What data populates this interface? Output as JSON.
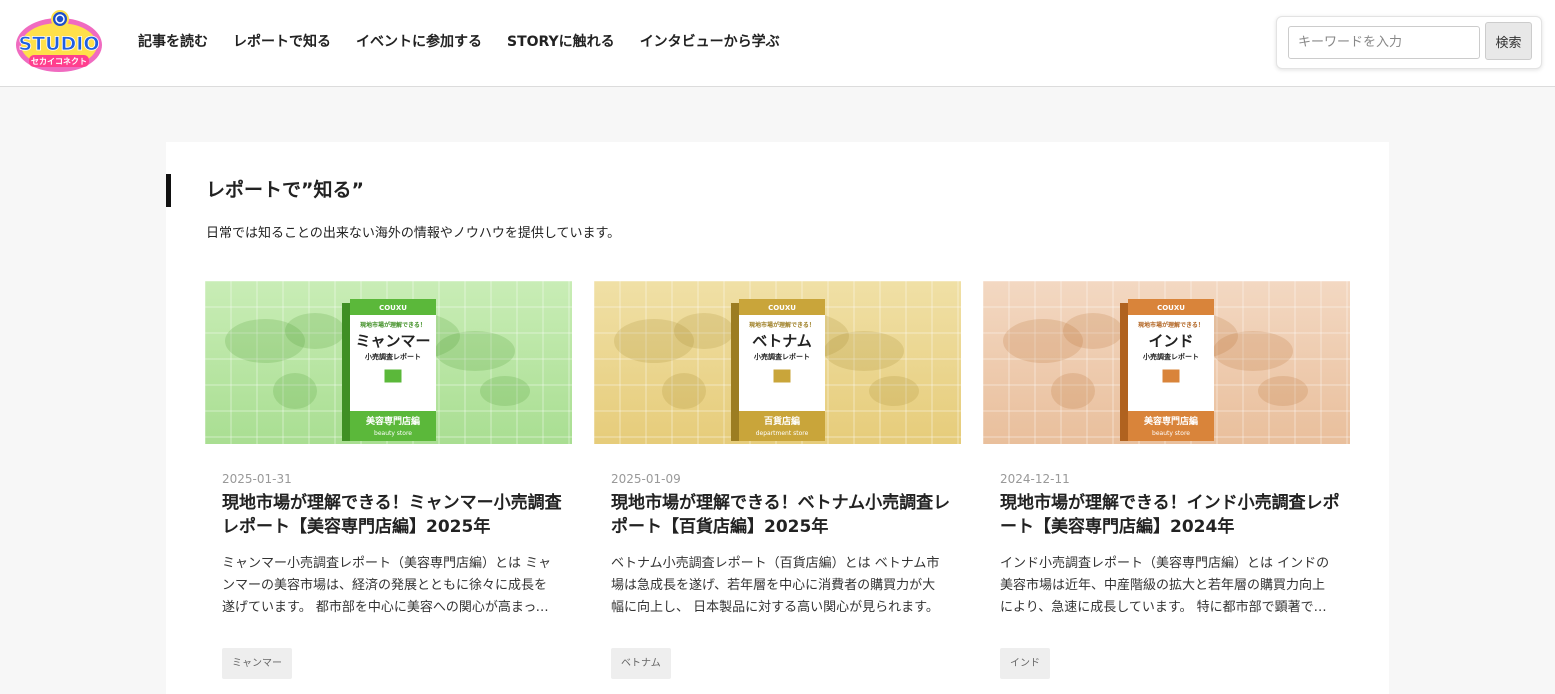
{
  "header": {
    "logo_text": "STUDIO",
    "logo_sub": "セカイコネクト",
    "nav": [
      "記事を読む",
      "レポートで知る",
      "イベントに参加する",
      "STORYに触れる",
      "インタビューから学ぶ"
    ],
    "search_placeholder": "キーワードを入力",
    "search_button": "検索"
  },
  "section": {
    "title": "レポートで”知る”",
    "description": "日常では知ることの出来ない海外の情報やノウハウを提供しています。"
  },
  "cards": [
    {
      "date": "2025-01-31",
      "title": "現地市場が理解できる！ミャンマー小売調査レポート【美容専門店編】2025年",
      "excerpt": "ミャンマー小売調査レポート（美容専門店編）とは ミャンマーの美容市場は、経済の発展とともに徐々に成長を遂げています。 都市部を中心に美容への関心が高まっています。",
      "tag": "ミャンマー",
      "book": {
        "brand": "COUXU",
        "pre": "現地市場が理解できる！",
        "country": "ミャンマー",
        "report": "小売調査レポート",
        "category": "美容専門店編",
        "category_en": "beauty store"
      },
      "colors": {
        "bg": "#c9edb6",
        "bg2": "#a9de92",
        "book": "#5bb83a",
        "dark": "#3f8f24"
      }
    },
    {
      "date": "2025-01-09",
      "title": "現地市場が理解できる！ベトナム小売調査レポート【百貨店編】2025年",
      "excerpt": "ベトナム小売調査レポート（百貨店編）とは ベトナム市場は急成長を遂げ、若年層を中心に消費者の購買力が大幅に向上し、 日本製品に対する高い関心が見られます。",
      "tag": "ベトナム",
      "book": {
        "brand": "COUXU",
        "pre": "現地市場が理解できる！",
        "country": "ベトナム",
        "report": "小売調査レポート",
        "category": "百貨店編",
        "category_en": "department store"
      },
      "colors": {
        "bg": "#f0e0a6",
        "bg2": "#e6cc7a",
        "book": "#c9a53a",
        "dark": "#9c7d22"
      }
    },
    {
      "date": "2024-12-11",
      "title": "現地市場が理解できる！インド小売調査レポート【美容専門店編】2024年",
      "excerpt": "インド小売調査レポート（美容専門店編）とは インドの美容市場は近年、中産階級の拡大と若年層の購買力向上により、急速に成長しています。 特に都市部で顕著です。",
      "tag": "インド",
      "book": {
        "brand": "COUXU",
        "pre": "現地市場が理解できる！",
        "country": "インド",
        "report": "小売調査レポート",
        "category": "美容専門店編",
        "category_en": "beauty store"
      },
      "colors": {
        "bg": "#f3d8c2",
        "bg2": "#e9bf9c",
        "book": "#d9843a",
        "dark": "#b0621f"
      }
    }
  ]
}
